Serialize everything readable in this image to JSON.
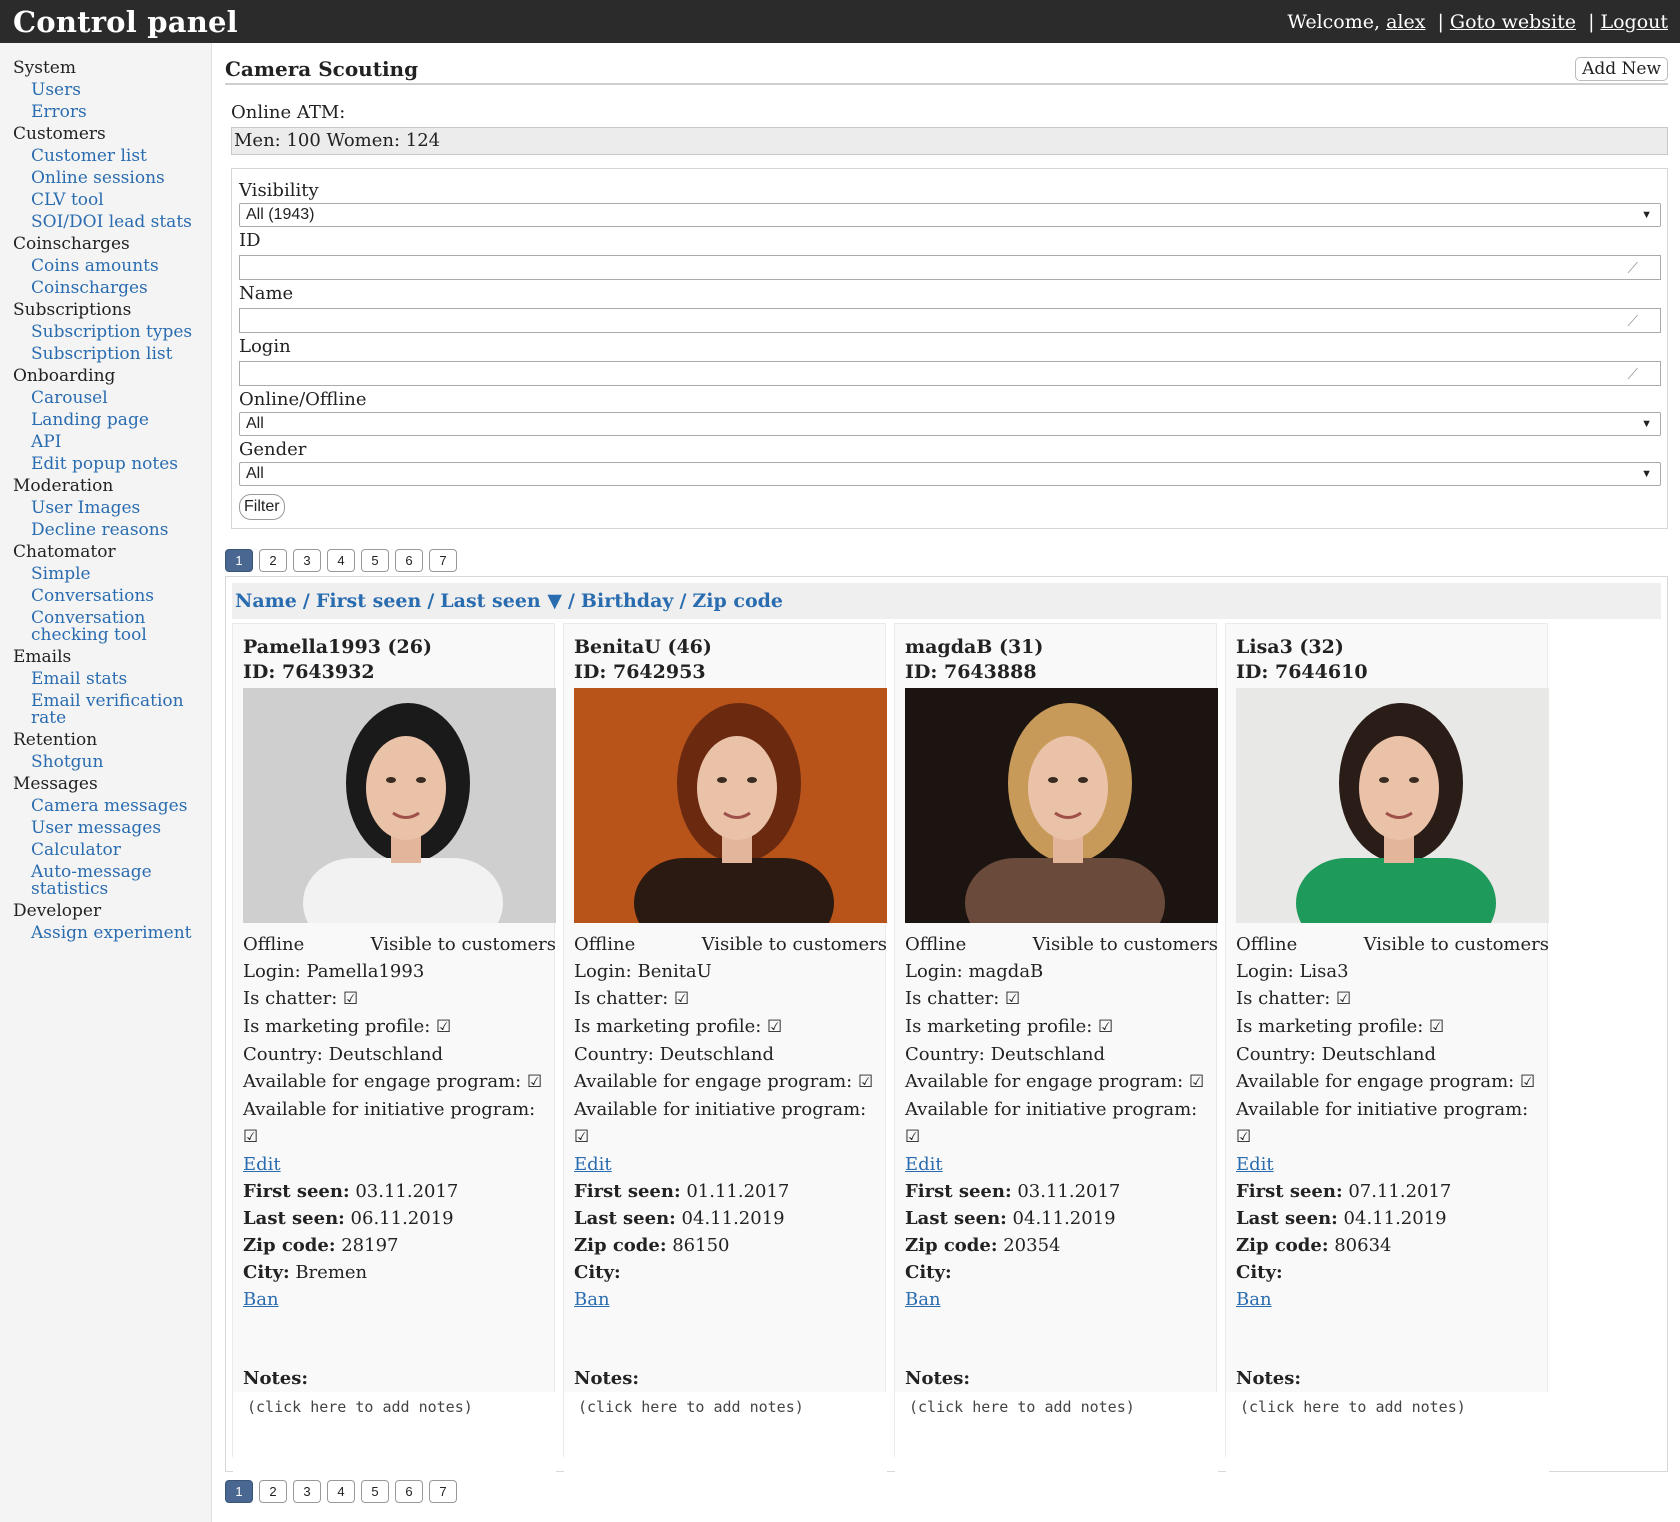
{
  "header": {
    "brand": "Control panel",
    "welcome": "Welcome,",
    "user": "alex",
    "goto": "Goto website",
    "logout": "Logout",
    "sep": "|"
  },
  "sidebar": [
    {
      "type": "group",
      "label": "System"
    },
    {
      "type": "item",
      "label": "Users"
    },
    {
      "type": "item",
      "label": "Errors"
    },
    {
      "type": "group",
      "label": "Customers"
    },
    {
      "type": "item",
      "label": "Customer list"
    },
    {
      "type": "item",
      "label": "Online sessions"
    },
    {
      "type": "item",
      "label": "CLV tool"
    },
    {
      "type": "item",
      "label": "SOI/DOI lead stats"
    },
    {
      "type": "group",
      "label": "Coinscharges"
    },
    {
      "type": "item",
      "label": "Coins amounts"
    },
    {
      "type": "item",
      "label": "Coinscharges"
    },
    {
      "type": "group",
      "label": "Subscriptions"
    },
    {
      "type": "item",
      "label": "Subscription types"
    },
    {
      "type": "item",
      "label": "Subscription list"
    },
    {
      "type": "group",
      "label": "Onboarding"
    },
    {
      "type": "item",
      "label": "Carousel"
    },
    {
      "type": "item",
      "label": "Landing page"
    },
    {
      "type": "item",
      "label": "API"
    },
    {
      "type": "item",
      "label": "Edit popup notes"
    },
    {
      "type": "group",
      "label": "Moderation"
    },
    {
      "type": "item",
      "label": "User Images"
    },
    {
      "type": "item",
      "label": "Decline reasons"
    },
    {
      "type": "group",
      "label": "Chatomator"
    },
    {
      "type": "item",
      "label": "Simple"
    },
    {
      "type": "item",
      "label": "Conversations"
    },
    {
      "type": "item",
      "label": "Conversation checking tool",
      "wrap": true
    },
    {
      "type": "group",
      "label": "Emails"
    },
    {
      "type": "item",
      "label": "Email stats"
    },
    {
      "type": "item",
      "label": "Email verification rate",
      "wrap": true
    },
    {
      "type": "group",
      "label": "Retention"
    },
    {
      "type": "item",
      "label": "Shotgun"
    },
    {
      "type": "group",
      "label": "Messages"
    },
    {
      "type": "item",
      "label": "Camera messages"
    },
    {
      "type": "item",
      "label": "User messages"
    },
    {
      "type": "item",
      "label": "Calculator"
    },
    {
      "type": "item",
      "label": "Auto-message statistics",
      "wrap": true
    },
    {
      "type": "group",
      "label": "Developer"
    },
    {
      "type": "item",
      "label": "Assign experiment"
    }
  ],
  "page": {
    "title": "Camera Scouting",
    "add_new": "Add New",
    "online_label": "Online ATM:",
    "online_value": "Men: 100 Women: 124"
  },
  "filters": {
    "visibility_label": "Visibility",
    "visibility_value": "All (1943)",
    "id_label": "ID",
    "name_label": "Name",
    "login_label": "Login",
    "online_label": "Online/Offline",
    "online_value": "All",
    "gender_label": "Gender",
    "gender_value": "All",
    "filter_button": "Filter"
  },
  "pager": [
    "1",
    "2",
    "3",
    "4",
    "5",
    "6",
    "7"
  ],
  "sort": {
    "name": "Name",
    "first_seen": "First seen",
    "last_seen": "Last seen ▼",
    "birthday": "Birthday",
    "zip": "Zip code",
    "sep": "/"
  },
  "card_labels": {
    "login": "Login:",
    "is_chatter": "Is chatter:",
    "is_marketing": "Is marketing profile:",
    "country": "Country:",
    "engage": "Available for engage program:",
    "initiative": "Available for initiative program:",
    "edit": "Edit",
    "first_seen": "First seen:",
    "last_seen": "Last seen:",
    "zip": "Zip code:",
    "city": "City:",
    "ban": "Ban",
    "notes": "Notes:",
    "notes_placeholder": "(click here to add notes)",
    "check": "☑"
  },
  "profiles": [
    {
      "title": "Pamella1993 (26)",
      "id": "ID: 7643932",
      "status": "Offline",
      "visibility": "Visible to customers",
      "login": "Pamella1993",
      "country": "Deutschland",
      "first_seen": "03.11.2017",
      "last_seen": "06.11.2019",
      "zip": "28197",
      "city": "Bremen",
      "photo_bg": "#cfcfcf",
      "hair": "#1a1a1a",
      "top": "#f2f2f2"
    },
    {
      "title": "BenitaU (46)",
      "id": "ID: 7642953",
      "status": "Offline",
      "visibility": "Visible to customers",
      "login": "BenitaU",
      "country": "Deutschland",
      "first_seen": "01.11.2017",
      "last_seen": "04.11.2019",
      "zip": "86150",
      "city": "",
      "photo_bg": "#b8531a",
      "hair": "#6b2a10",
      "top": "#2a1a12"
    },
    {
      "title": "magdaB (31)",
      "id": "ID: 7643888",
      "status": "Offline",
      "visibility": "Visible to customers",
      "login": "magdaB",
      "country": "Deutschland",
      "first_seen": "03.11.2017",
      "last_seen": "04.11.2019",
      "zip": "20354",
      "city": "",
      "photo_bg": "#1c1410",
      "hair": "#c79a5a",
      "top": "#6a4a3a"
    },
    {
      "title": "Lisa3 (32)",
      "id": "ID: 7644610",
      "status": "Offline",
      "visibility": "Visible to customers",
      "login": "Lisa3",
      "country": "Deutschland",
      "first_seen": "07.11.2017",
      "last_seen": "04.11.2019",
      "zip": "80634",
      "city": "",
      "photo_bg": "#e8e8e6",
      "hair": "#2a1c16",
      "top": "#1e9a5a"
    }
  ]
}
